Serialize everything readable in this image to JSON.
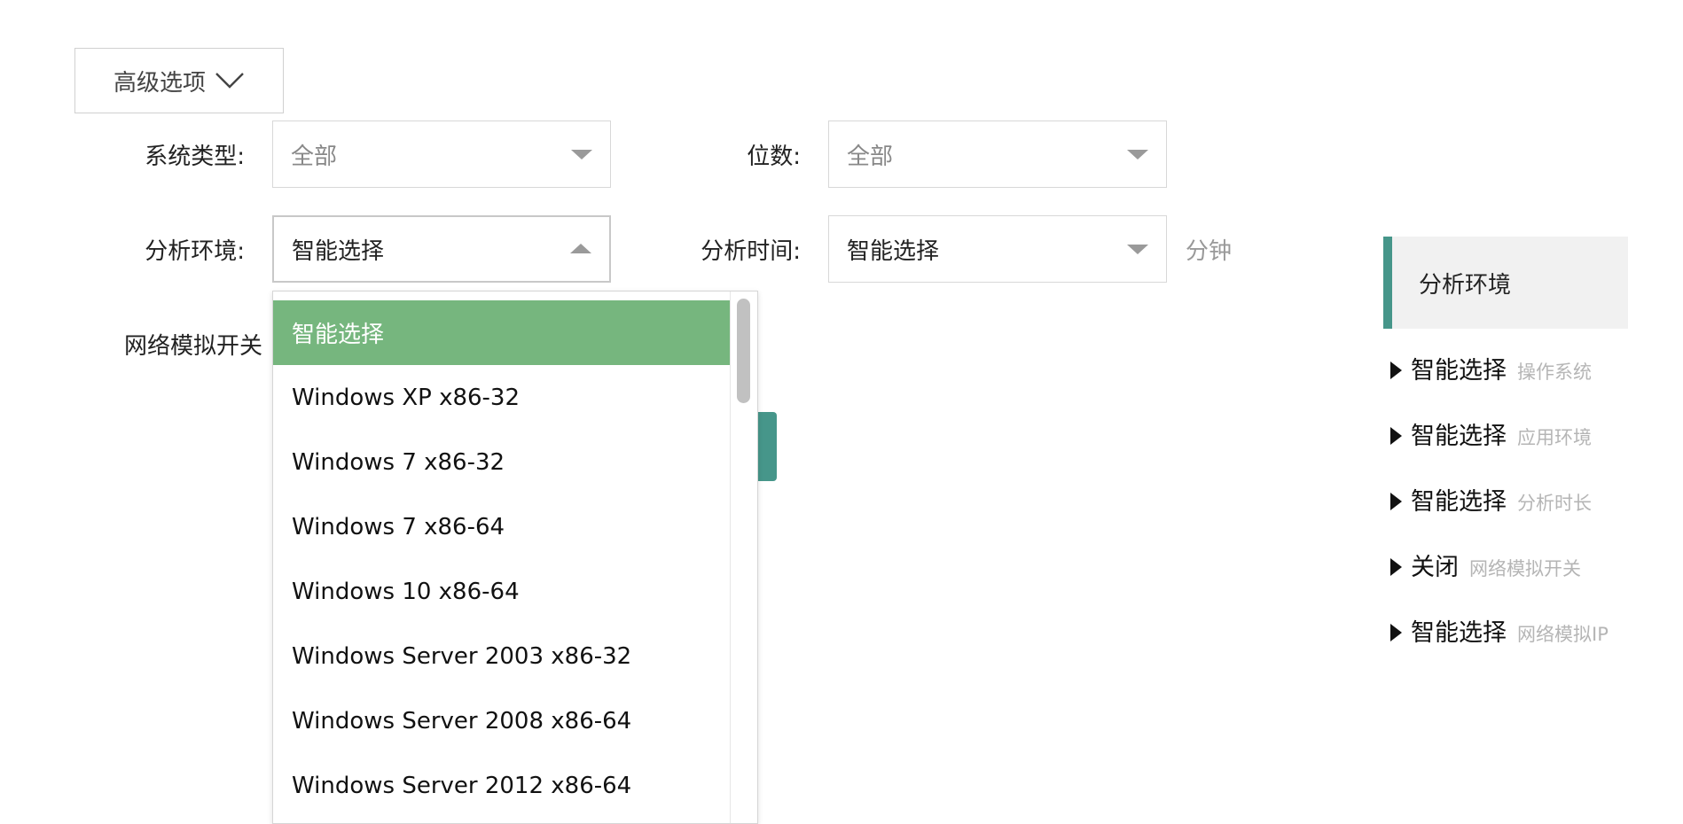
{
  "advanced": {
    "label": "高级选项",
    "icon": "chevron-down-icon"
  },
  "form": {
    "system_type": {
      "label": "系统类型:",
      "value": "全部"
    },
    "bits": {
      "label": "位数:",
      "value": "全部"
    },
    "env": {
      "label": "分析环境:",
      "value": "智能选择"
    },
    "time": {
      "label": "分析时间:",
      "value": "智能选择",
      "suffix": "分钟"
    },
    "network": {
      "label": "网络模拟开关"
    }
  },
  "dropdown": {
    "options": [
      "智能选择",
      "Windows XP x86-32",
      "Windows 7 x86-32",
      "Windows 7 x86-64",
      "Windows 10 x86-64",
      "Windows Server 2003 x86-32",
      "Windows Server 2008 x86-64",
      "Windows Server 2012 x86-64"
    ],
    "selected_index": 0
  },
  "panel": {
    "title": "分析环境",
    "items": [
      {
        "value": "智能选择",
        "caption": "操作系统"
      },
      {
        "value": "智能选择",
        "caption": "应用环境"
      },
      {
        "value": "智能选择",
        "caption": "分析时长"
      },
      {
        "value": "关闭",
        "caption": "网络模拟开关"
      },
      {
        "value": "智能选择",
        "caption": "网络模拟IP"
      }
    ]
  },
  "colors": {
    "accent": "#46968a",
    "selected_option": "#76b67e"
  }
}
